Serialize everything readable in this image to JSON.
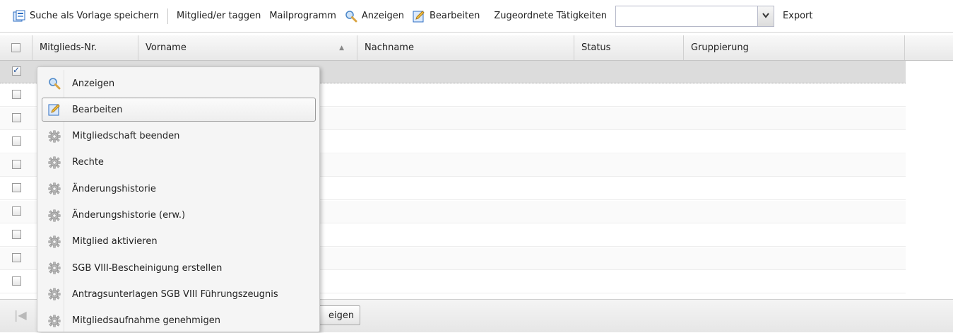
{
  "toolbar": {
    "save_search": "Suche als Vorlage speichern",
    "tag_members": "Mitglied/er taggen",
    "mail_program": "Mailprogramm",
    "view": "Anzeigen",
    "edit": "Bearbeiten",
    "activities_label": "Zugeordnete Tätigkeiten",
    "activities_value": "",
    "export": "Export"
  },
  "columns": {
    "member_no": "Mitglieds-Nr.",
    "first_name": "Vorname",
    "last_name": "Nachname",
    "status": "Status",
    "group": "Gruppierung"
  },
  "rows": [
    {
      "checked": true
    },
    {
      "checked": false
    },
    {
      "checked": false
    },
    {
      "checked": false
    },
    {
      "checked": false
    },
    {
      "checked": false
    },
    {
      "checked": false
    },
    {
      "checked": false
    },
    {
      "checked": false
    },
    {
      "checked": false
    }
  ],
  "context_menu": {
    "items": [
      {
        "label": "Anzeigen",
        "icon": "magnifier-icon"
      },
      {
        "label": "Bearbeiten",
        "icon": "pencil-edit-icon",
        "active": true
      },
      {
        "label": "Mitgliedschaft beenden",
        "icon": "gear-icon"
      },
      {
        "label": "Rechte",
        "icon": "gear-icon"
      },
      {
        "label": "Änderungshistorie",
        "icon": "gear-icon"
      },
      {
        "label": "Änderungshistorie (erw.)",
        "icon": "gear-icon"
      },
      {
        "label": "Mitglied aktivieren",
        "icon": "gear-icon"
      },
      {
        "label": "SGB VIII-Bescheinigung erstellen",
        "icon": "gear-icon"
      },
      {
        "label": "Antragsunterlagen SGB VIII Führungszeugnis",
        "icon": "gear-icon"
      },
      {
        "label": "Mitgliedsaufnahme genehmigen",
        "icon": "gear-icon"
      }
    ]
  },
  "paging": {
    "button_label": "eigen"
  },
  "colors": {
    "selected_row": "#dcdcdc",
    "menu_bg": "#f5f5f5",
    "accent_blue": "#2f6fc3"
  }
}
